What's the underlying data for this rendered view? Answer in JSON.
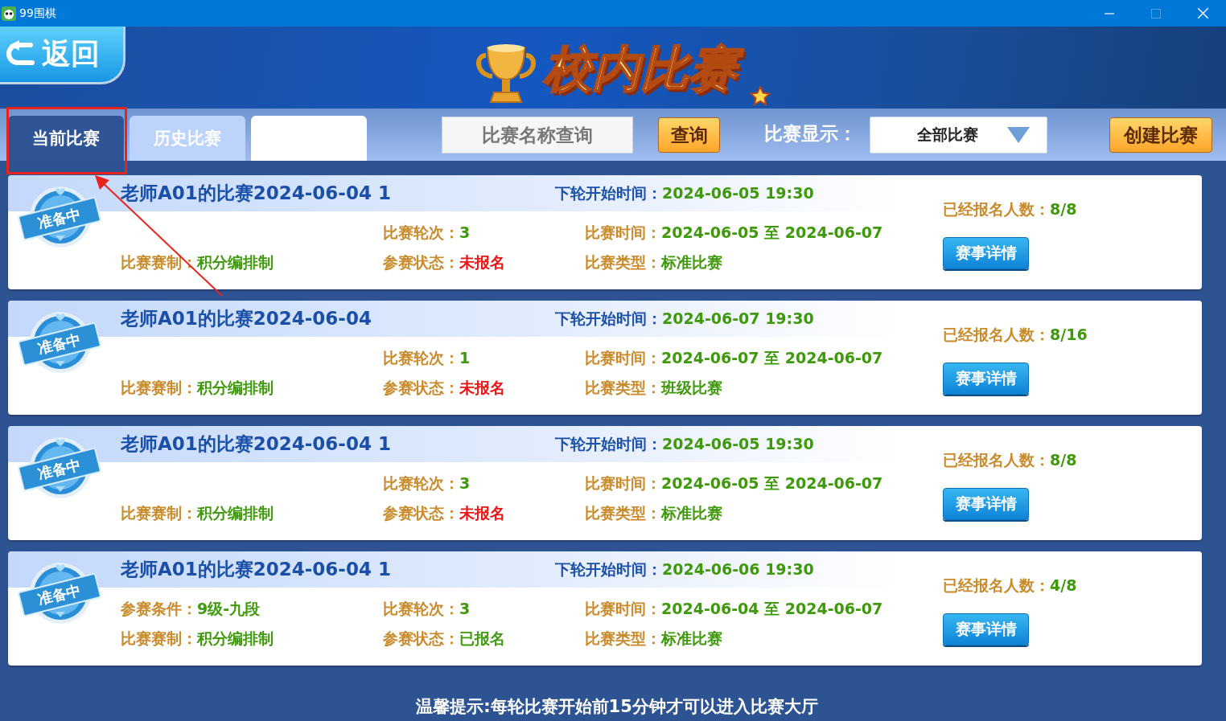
{
  "window": {
    "title": "99围棋"
  },
  "header": {
    "back_button": "返回",
    "title": "校内比赛"
  },
  "tabs": [
    {
      "label": "当前比赛",
      "selected": true
    },
    {
      "label": "历史比赛",
      "selected": false
    },
    {
      "selected": false
    }
  ],
  "search": {
    "placeholder": "比赛名称查询",
    "button": "查询"
  },
  "filter": {
    "label": "比赛显示：",
    "value": "全部比赛"
  },
  "create_button": "创建比赛",
  "matches": [
    {
      "badge": "准备中",
      "title": "老师A01的比赛2024-06-04 1",
      "next_round": {
        "label": "下轮开始时间：",
        "value": "2024-06-05 19:30"
      },
      "signup": {
        "label": "已经报名人数：",
        "value": "8/8"
      },
      "left": [
        {
          "label": "比赛赛制：",
          "value": "积分编排制"
        }
      ],
      "middle": [
        {
          "label": "比赛轮次：",
          "value": "3"
        },
        {
          "label": "参赛状态：",
          "value": "未报名",
          "registered": false
        }
      ],
      "right": [
        {
          "label": "比赛时间：",
          "value": "2024-06-05 至 2024-06-07"
        },
        {
          "label": "比赛类型：",
          "value": "标准比赛"
        }
      ],
      "button": "赛事详情"
    },
    {
      "badge": "准备中",
      "title": "老师A01的比赛2024-06-04",
      "next_round": {
        "label": "下轮开始时间：",
        "value": "2024-06-07 19:30"
      },
      "signup": {
        "label": "已经报名人数：",
        "value": "8/16"
      },
      "left": [
        {
          "label": "比赛赛制：",
          "value": "积分编排制"
        }
      ],
      "middle": [
        {
          "label": "比赛轮次：",
          "value": "1"
        },
        {
          "label": "参赛状态：",
          "value": "未报名",
          "registered": false
        }
      ],
      "right": [
        {
          "label": "比赛时间：",
          "value": "2024-06-07 至 2024-06-07"
        },
        {
          "label": "比赛类型：",
          "value": "班级比赛"
        }
      ],
      "button": "赛事详情"
    },
    {
      "badge": "准备中",
      "title": "老师A01的比赛2024-06-04 1",
      "next_round": {
        "label": "下轮开始时间：",
        "value": "2024-06-05 19:30"
      },
      "signup": {
        "label": "已经报名人数：",
        "value": "8/8"
      },
      "left": [
        {
          "label": "比赛赛制：",
          "value": "积分编排制"
        }
      ],
      "middle": [
        {
          "label": "比赛轮次：",
          "value": "3"
        },
        {
          "label": "参赛状态：",
          "value": "未报名",
          "registered": false
        }
      ],
      "right": [
        {
          "label": "比赛时间：",
          "value": "2024-06-05 至 2024-06-07"
        },
        {
          "label": "比赛类型：",
          "value": "标准比赛"
        }
      ],
      "button": "赛事详情"
    },
    {
      "badge": "准备中",
      "title": "老师A01的比赛2024-06-04 1",
      "next_round": {
        "label": "下轮开始时间：",
        "value": "2024-06-06 19:30"
      },
      "signup": {
        "label": "已经报名人数：",
        "value": "4/8"
      },
      "left": [
        {
          "label": "参赛条件：",
          "value": "9级-九段"
        },
        {
          "label": "比赛赛制：",
          "value": "积分编排制"
        }
      ],
      "middle": [
        {
          "label": "比赛轮次：",
          "value": "3"
        },
        {
          "label": "参赛状态：",
          "value": "已报名",
          "registered": true
        }
      ],
      "right": [
        {
          "label": "比赛时间：",
          "value": "2024-06-04 至 2024-06-07"
        },
        {
          "label": "比赛类型：",
          "value": "标准比赛"
        }
      ],
      "button": "赛事详情"
    }
  ],
  "hint": "温馨提示:每轮比赛开始前15分钟才可以进入比赛大厅"
}
